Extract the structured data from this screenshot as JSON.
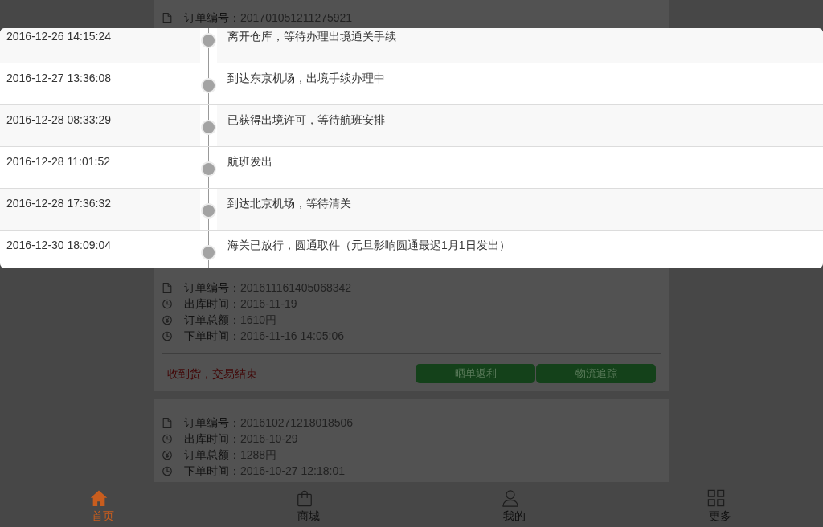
{
  "tracking_dialog": {
    "events": [
      {
        "time": "2016-12-26 14:15:24",
        "description": "离开仓库，等待办理出境通关手续"
      },
      {
        "time": "2016-12-27 13:36:08",
        "description": "到达东京机场，出境手续办理中"
      },
      {
        "time": "2016-12-28 08:33:29",
        "description": "已获得出境许可，等待航班安排"
      },
      {
        "time": "2016-12-28 11:01:52",
        "description": "航班发出"
      },
      {
        "time": "2016-12-28 17:36:32",
        "description": "到达北京机场，等待清关"
      },
      {
        "time": "2016-12-30 18:09:04",
        "description": "海关已放行，圆通取件（元旦影响圆通最迟1月1日发出）"
      }
    ]
  },
  "orders": [
    {
      "fields": [
        {
          "kind": "order_no",
          "label": "订单编号：",
          "value": "201701051211275921"
        }
      ]
    },
    {
      "fields": [
        {
          "kind": "order_no",
          "label": "订单编号：",
          "value": "201611161405068342"
        },
        {
          "kind": "ship_time",
          "label": "出库时间：",
          "value": "2016-11-19"
        },
        {
          "kind": "total",
          "label": "订单总额：",
          "value": "1610円"
        },
        {
          "kind": "order_time",
          "label": "下单时间：",
          "value": "2016-11-16 14:05:06"
        }
      ],
      "status": "收到货，交易结束",
      "actions": [
        "晒单返利",
        "物流追踪"
      ]
    },
    {
      "fields": [
        {
          "kind": "order_no",
          "label": "订单编号：",
          "value": "201610271218018506"
        },
        {
          "kind": "ship_time",
          "label": "出库时间：",
          "value": "2016-10-29"
        },
        {
          "kind": "total",
          "label": "订单总额：",
          "value": "1288円"
        },
        {
          "kind": "order_time",
          "label": "下单时间：",
          "value": "2016-10-27 12:18:01"
        }
      ]
    }
  ],
  "bottom_nav": [
    {
      "kind": "home",
      "label": "首页",
      "selected": true
    },
    {
      "kind": "shop",
      "label": "商城",
      "selected": false
    },
    {
      "kind": "profile",
      "label": "我的",
      "selected": false
    },
    {
      "kind": "more",
      "label": "更多",
      "selected": false
    }
  ]
}
